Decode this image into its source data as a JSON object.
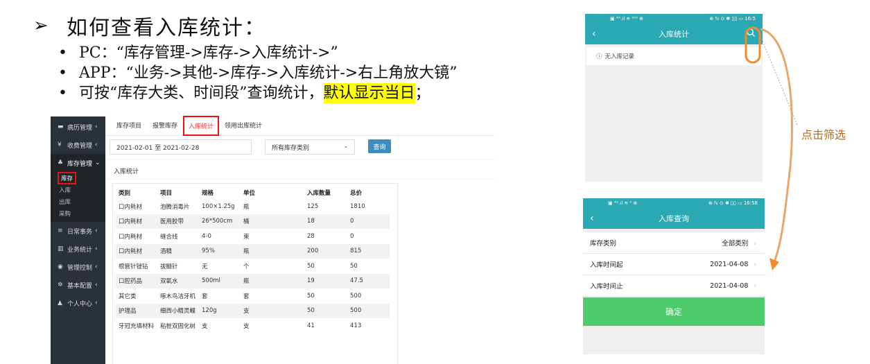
{
  "slide": {
    "bullet_arrow": "➢",
    "title": "如何查看入库统计：",
    "bullets": [
      "PC：“库存管理->库存->入库统计->”",
      "APP：“业务->其他->库存->入库统计->右上角放大镜”",
      "可按“库存大类、时间段”查询统计，"
    ],
    "highlight": "默认显示当日",
    "highlight_tail": "；",
    "bullet_dot": "•"
  },
  "pc": {
    "sidebar": [
      {
        "label": "病历管理",
        "icon": "bed-icon",
        "glyph": "▬"
      },
      {
        "label": "收费管理",
        "icon": "yen-icon",
        "glyph": "¥"
      },
      {
        "label": "库存管理",
        "icon": "cubes-icon",
        "glyph": "♣"
      }
    ],
    "sidebar_sub": [
      "库存",
      "入库",
      "出库",
      "采购"
    ],
    "sidebar_after": [
      {
        "label": "日常事务",
        "icon": "list-icon",
        "glyph": "≡"
      },
      {
        "label": "业务统计",
        "icon": "bar-chart-icon",
        "glyph": "▥"
      },
      {
        "label": "管理控制",
        "icon": "dashboard-icon",
        "glyph": "◉"
      },
      {
        "label": "基本配置",
        "icon": "gear-icon",
        "glyph": "✲"
      },
      {
        "label": "个人中心",
        "icon": "user-icon",
        "glyph": "▲"
      }
    ],
    "caret_right": "‹",
    "caret_down": "⌄",
    "tabs": [
      "库存项目",
      "报警库存",
      "入库统计",
      "领用出库统计"
    ],
    "date_range": "2021-02-01 至 2021-02-28",
    "category_select": "所有库存类别",
    "query_label": "查询",
    "section_label": "入库统计",
    "columns": [
      "类别",
      "项目",
      "规格",
      "单位",
      "入库数量",
      "总价"
    ],
    "rows": [
      [
        "口内耗材",
        "泡腾消毒片",
        "100×1.25g",
        "瓶",
        "125",
        "1810"
      ],
      [
        "口内耗材",
        "医用胶带",
        "26*500cm",
        "桶",
        "18",
        "0"
      ],
      [
        "口内耗材",
        "缝合线",
        "4-0",
        "束",
        "28",
        "0"
      ],
      [
        "口内耗材",
        "酒精",
        "95%",
        "瓶",
        "200",
        "815"
      ],
      [
        "根管针锉钻",
        "拔髓针",
        "无",
        "个",
        "50",
        "50"
      ],
      [
        "口腔药品",
        "双氧水",
        "500ml",
        "瓶",
        "19",
        "47.5"
      ],
      [
        "其它类",
        "啄木鸟洁牙机",
        "套",
        "套",
        "50",
        "500"
      ],
      [
        "护理品",
        "细西小精灵鲽",
        "120g",
        "支",
        "50",
        "500"
      ],
      [
        "牙冠充填材料",
        "粘桩双固化树",
        "支",
        "支",
        "41",
        "413"
      ]
    ]
  },
  "phone1": {
    "status_left": "▣ ⁴ᴳ.ıl ≋ ²⁰⁰ ⊕",
    "status_right": "⊛ ℕ ⊙ ✱ ▯▯ ▭ 16:5",
    "title": "入库统计",
    "back": "‹",
    "empty_icon": "ⓘ",
    "empty_text": "无入库记录"
  },
  "phone2": {
    "status_left": "▣ ⁴ᴳ.ıl ≋ ⁰ ⊕",
    "status_right": "⊛ ℕ ⊙ ✱ ▯▯ ▭ 16:58",
    "title": "入库查询",
    "back": "‹",
    "rows": [
      {
        "label": "库存类别",
        "value": "全部类别"
      },
      {
        "label": "入库时间起",
        "value": "2021-04-08"
      },
      {
        "label": "入库时间止",
        "value": "2021-04-08"
      }
    ],
    "chevron": "›",
    "confirm": "确定"
  },
  "annotation": {
    "text": "点击筛选",
    "color": "#b46b1a",
    "accent": "#f08c2a"
  }
}
